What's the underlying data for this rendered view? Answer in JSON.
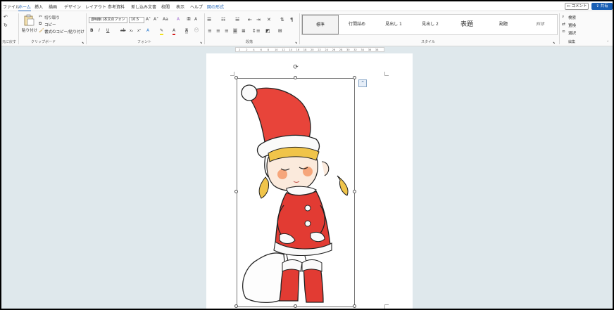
{
  "menu": {
    "tabs": [
      "ファイル",
      "ホーム",
      "挿入",
      "描画",
      "デザイン",
      "レイアウト",
      "参考資料",
      "差し込み文書",
      "校閲",
      "表示",
      "ヘルプ",
      "図の形式"
    ],
    "comment": "コメント",
    "share": "共有"
  },
  "ribbon": {
    "undo_group": "元に戻す",
    "clipboard": {
      "paste": "貼り付け",
      "cut": "切り取り",
      "copy": "コピー",
      "format_painter": "書式のコピー/貼り付け",
      "label": "クリップボード"
    },
    "font": {
      "name": "游明朝 (本文のフォン",
      "size": "10.5",
      "label": "フォント"
    },
    "paragraph_label": "段落",
    "styles": {
      "items": [
        "標準",
        "行間詰め",
        "見出し 1",
        "見出し 2",
        "表題",
        "副題",
        "斜体"
      ],
      "label": "スタイル"
    },
    "editing": {
      "find": "検索",
      "replace": "置換",
      "select": "選択",
      "label": "編集"
    }
  },
  "ruler": {
    "ticks": [
      "2",
      "2",
      "4",
      "6",
      "8",
      "10",
      "12",
      "14",
      "16",
      "18",
      "20",
      "22",
      "24",
      "26",
      "28",
      "30",
      "32",
      "34",
      "36",
      "38"
    ]
  },
  "icons": [
    "undo-icon",
    "redo-icon",
    "paste-icon",
    "cut-icon",
    "copy-icon",
    "format-painter-icon",
    "bold-icon",
    "italic-icon",
    "underline-icon",
    "rotate-icon",
    "layout-options-icon"
  ],
  "colors": {
    "accent": "#1a5fb4",
    "santa_red": "#d8322a"
  }
}
